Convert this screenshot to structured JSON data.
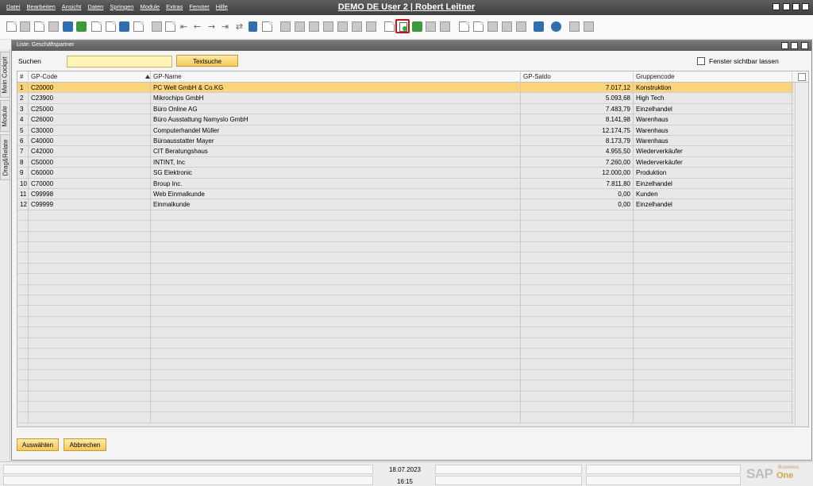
{
  "menu": [
    "Datei",
    "Bearbeiten",
    "Ansicht",
    "Daten",
    "Springen",
    "Module",
    "Extras",
    "Fenster",
    "Hilfe"
  ],
  "app_title": "DEMO DE User 2 | Robert Leitner",
  "side_tabs": [
    "Mein Cockpit",
    "Module",
    "Drag&Relate"
  ],
  "window": {
    "title": "Liste: Geschäftspartner",
    "search_label": "Suchen",
    "search_value": "",
    "text_search_label": "Textsuche",
    "keep_visible_label": "Fenster sichtbar lassen",
    "keep_visible_checked": false
  },
  "table": {
    "columns": [
      "#",
      "GP-Code",
      "GP-Name",
      "GP-Saldo",
      "Gruppencode"
    ],
    "rows": [
      [
        "1",
        "C20000",
        "PC Welt GmbH & Co.KG",
        "7.017,12",
        "Konstruktion"
      ],
      [
        "2",
        "C23900",
        "Mikrochips GmbH",
        "5.093,68",
        "High Tech"
      ],
      [
        "3",
        "C25000",
        "Büro Online AG",
        "7.483,79",
        "Einzelhandel"
      ],
      [
        "4",
        "C26000",
        "Büro Ausstattung Namyslo GmbH",
        "8.141,98",
        "Warenhaus"
      ],
      [
        "5",
        "C30000",
        "Computerhandel Müller",
        "12.174,75",
        "Warenhaus"
      ],
      [
        "6",
        "C40000",
        "Büroausstatter Mayer",
        "8.173,79",
        "Warenhaus"
      ],
      [
        "7",
        "C42000",
        "CIT Beratungshaus",
        "4.955,50",
        "Wiederverkäufer"
      ],
      [
        "8",
        "C50000",
        "INTINT, Inc",
        "7.260,00",
        "Wiederverkäufer"
      ],
      [
        "9",
        "C60000",
        "SG Elektronic",
        "12.000,00",
        "Produktion"
      ],
      [
        "10",
        "C70000",
        "Broup Inc.",
        "7.811,80",
        "Einzelhandel"
      ],
      [
        "11",
        "C99998",
        "Web Einmalkunde",
        "0,00",
        "Kunden"
      ],
      [
        "12",
        "C99999",
        "Einmalkunde",
        "0,00",
        "Einzelhandel"
      ]
    ],
    "selected_row": 1
  },
  "buttons": {
    "choose": "Auswählen",
    "cancel": "Abbrechen"
  },
  "status": {
    "date": "18.07.2023",
    "time": "16:15"
  },
  "brand": {
    "sap": "SAP",
    "business": "Business",
    "one": "One"
  },
  "colors": {
    "accent": "#fbd47a",
    "button": "#f5c95a",
    "titlebar": "#4a4a4a",
    "highlight_border": "#d01010"
  }
}
